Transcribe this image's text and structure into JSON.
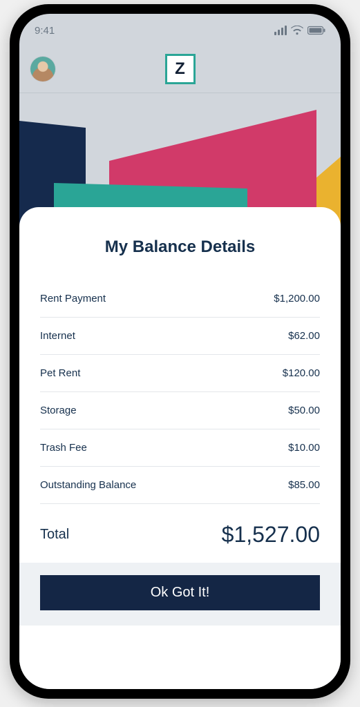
{
  "status": {
    "time": "9:41"
  },
  "header": {
    "logo_letter": "Z"
  },
  "sheet": {
    "title": "My Balance Details",
    "items": [
      {
        "label": "Rent Payment",
        "amount": "$1,200.00"
      },
      {
        "label": "Internet",
        "amount": "$62.00"
      },
      {
        "label": "Pet Rent",
        "amount": "$120.00"
      },
      {
        "label": "Storage",
        "amount": "$50.00"
      },
      {
        "label": "Trash Fee",
        "amount": "$10.00"
      },
      {
        "label": "Outstanding Balance",
        "amount": "$85.00"
      }
    ],
    "total_label": "Total",
    "total_amount": "$1,527.00",
    "cta_label": "Ok Got It!"
  },
  "colors": {
    "navy": "#152a4d",
    "teal": "#2aa596",
    "pink": "#d13a69",
    "gold": "#eab22f"
  }
}
